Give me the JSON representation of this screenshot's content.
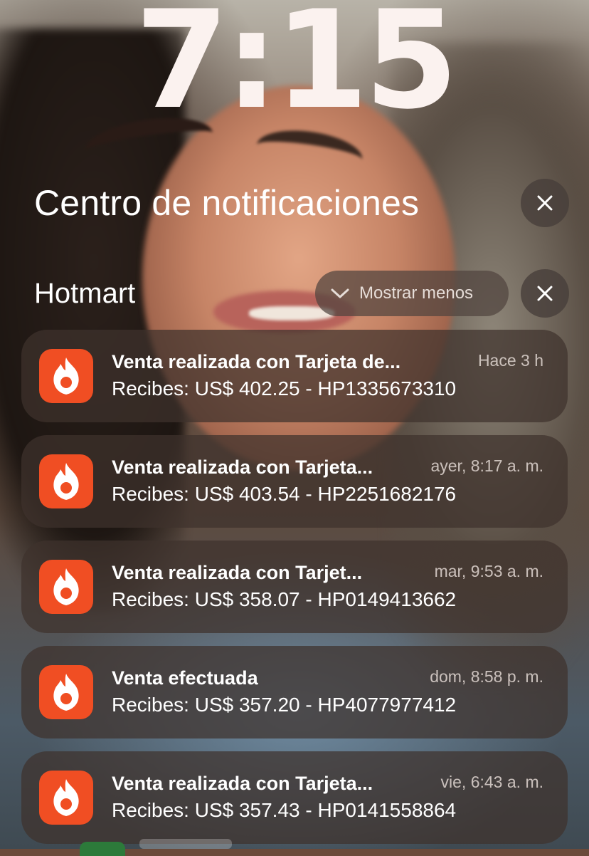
{
  "lock_screen": {
    "time": "7:15"
  },
  "notification_center": {
    "title": "Centro de notificaciones",
    "clear_icon": "close-icon"
  },
  "app_group": {
    "app_name": "Hotmart",
    "show_less_label": "Mostrar menos",
    "chevron_icon": "chevron-down-icon",
    "clear_icon": "close-icon"
  },
  "notifications": [
    {
      "title": "Venta realizada con Tarjeta de...",
      "body": "Recibes: US$ 402.25 - HP1335673310",
      "time": "Hace 3 h"
    },
    {
      "title": "Venta realizada con Tarjeta...",
      "body": "Recibes: US$ 403.54 - HP2251682176",
      "time": "ayer, 8:17 a. m."
    },
    {
      "title": "Venta realizada con Tarjet...",
      "body": "Recibes: US$ 358.07 - HP0149413662",
      "time": "mar, 9:53 a. m."
    },
    {
      "title": "Venta efectuada",
      "body": "Recibes: US$ 357.20 - HP4077977412",
      "time": "dom, 8:58 p. m."
    },
    {
      "title": "Venta realizada con Tarjeta...",
      "body": "Recibes: US$ 357.43 - HP0141558864",
      "time": "vie, 6:43 a. m."
    }
  ],
  "colors": {
    "hotmart_orange": "#f04e23",
    "text_white": "#ffffff"
  }
}
